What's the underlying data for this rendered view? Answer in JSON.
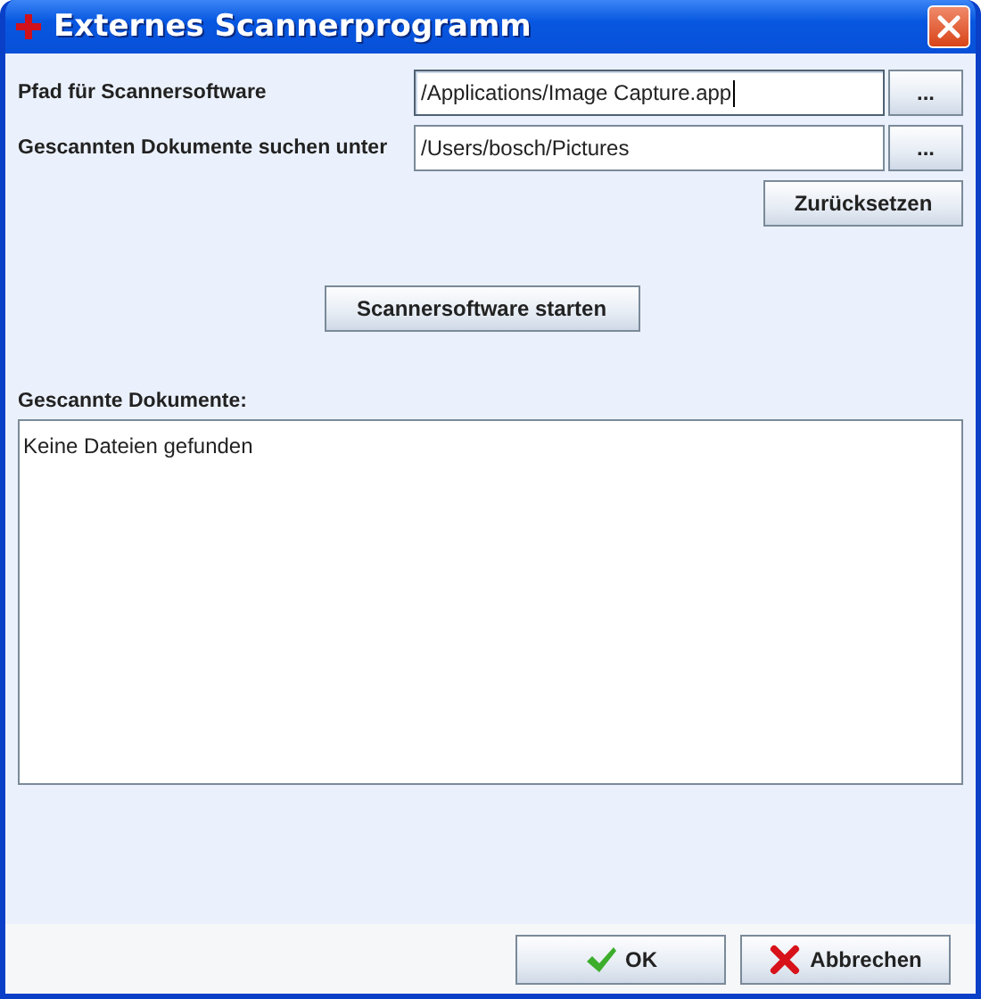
{
  "window": {
    "title": "Externes Scannerprogramm"
  },
  "paths": [
    {
      "label": "Pfad für Scannersoftware",
      "value": "/Applications/Image Capture.app",
      "browse": "...",
      "focused": true
    },
    {
      "label": "Gescannten Dokumente suchen unter",
      "value": "/Users/bosch/Pictures",
      "browse": "...",
      "focused": false
    }
  ],
  "reset_button": "Zurücksetzen",
  "start_button": "Scannersoftware starten",
  "documents": {
    "label": "Gescannte Dokumente:",
    "text": "Keine Dateien gefunden"
  },
  "buttons": [
    {
      "label": "OK",
      "kind": "ok"
    },
    {
      "label": "Abbrechen",
      "kind": "cancel"
    }
  ]
}
